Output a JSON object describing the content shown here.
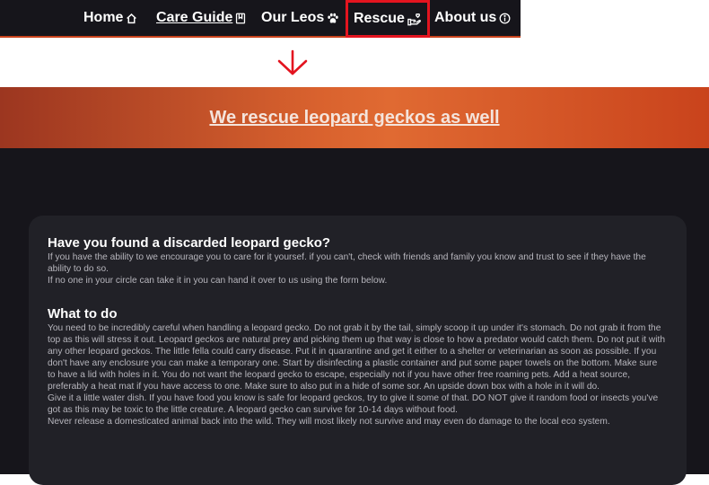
{
  "nav": {
    "items": [
      {
        "label": "Home",
        "icon": "home-icon"
      },
      {
        "label": "Care Guide",
        "icon": "book-icon"
      },
      {
        "label": "Our Leos",
        "icon": "paw-icon"
      },
      {
        "label": "Rescue",
        "icon": "hand-heart-icon"
      },
      {
        "label": "About us",
        "icon": "info-icon"
      }
    ],
    "active": "Rescue"
  },
  "colors": {
    "nav_bg": "#16151b",
    "accent": "#c9431c",
    "highlight": "#e3141f",
    "page_bg": "#16151b",
    "card_bg": "#212127"
  },
  "banner": {
    "title": "We rescue leopard geckos as well"
  },
  "found": {
    "heading": "Have you found a discarded leopard gecko?",
    "p1": "If you have the ability to we encourage you to care for it yoursef. if you can't, check with friends and family you know and trust to see if they have the ability to do so.",
    "p2": "If no one in your circle can take it in you can hand it over to us using the form below."
  },
  "what": {
    "heading": "What to do",
    "p1": "You need to be incredibly careful when handling a leopard gecko. Do not grab it by the tail, simply scoop it up under it's stomach. Do not grab it from the top as this will stress it out. Leopard geckos are natural prey and picking them up that way is close to how a predator would catch them. Do not put it with any other leopard geckos. The little fella could carry disease. Put it in quarantine and get it either to a shelter or veterinarian as soon as possible. If you don't have any enclosure you can make a temporary one. Start by disinfecting a plastic container and put some paper towels on the bottom. Make sure to have a lid with holes in it. You do not want the leopard gecko to escape, especially not if you have other free roaming pets. Add a heat source, preferably a heat mat if you have access to one. Make sure to also put in a hide of some sor. An upside down box with a hole in it will do.",
    "p2": "Give it a little water dish. If you have food you know is safe for leopard geckos, try to give it some of that. DO NOT give it random food or insects you've got as this may be toxic to the little creature. A leopard gecko can survive for 10-14 days without food.",
    "p3": "Never release a domesticated animal back into the wild. They will most likely not survive and may even do damage to the local eco system."
  }
}
